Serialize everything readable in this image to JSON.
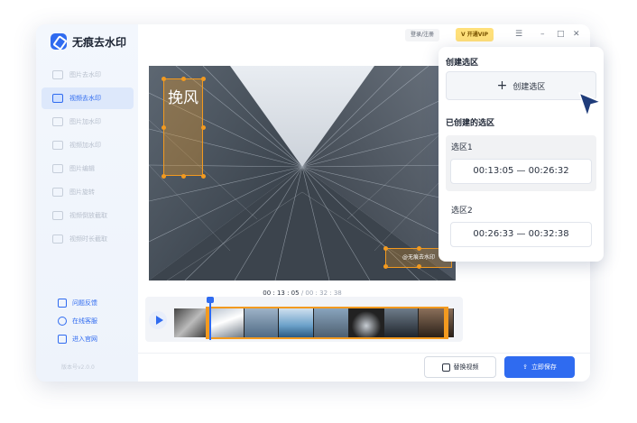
{
  "app": {
    "name": "无痕去水印",
    "version": "版本号v2.0.0"
  },
  "sidebar": {
    "items": [
      {
        "label": "图片去水印"
      },
      {
        "label": "视频去水印"
      },
      {
        "label": "图片加水印"
      },
      {
        "label": "视频加水印"
      },
      {
        "label": "图片编辑"
      },
      {
        "label": "图片旋转"
      },
      {
        "label": "视频倒放截取"
      },
      {
        "label": "视频时长截取"
      }
    ],
    "active_index": 1,
    "links": [
      {
        "label": "问题反馈",
        "icon": "feedback-icon"
      },
      {
        "label": "在线客服",
        "icon": "support-icon"
      },
      {
        "label": "进入官网",
        "icon": "website-icon"
      }
    ]
  },
  "topbar": {
    "login_label": "登录/注册",
    "vip_label": "V 开通VIP"
  },
  "preview": {
    "watermark_text_vertical": "挽风",
    "watermark_text_corner": "@无痕去水印"
  },
  "timeline": {
    "current": "00 : 13 : 05",
    "separator": " / ",
    "duration": "00 : 32 : 38"
  },
  "footer": {
    "replace_label": "替换视频",
    "save_label": "立即保存"
  },
  "region_panel": {
    "create_heading": "创建选区",
    "create_button_label": "创建选区",
    "created_heading": "已创建的选区",
    "regions": [
      {
        "name": "选区1",
        "range": "00:13:05 — 00:26:32"
      },
      {
        "name": "选区2",
        "range": "00:26:33 — 00:32:38"
      }
    ],
    "selected_index": 0
  },
  "colors": {
    "accent": "#2f6bf0",
    "selection": "#f39a1f",
    "vip": "#ffe07a"
  }
}
